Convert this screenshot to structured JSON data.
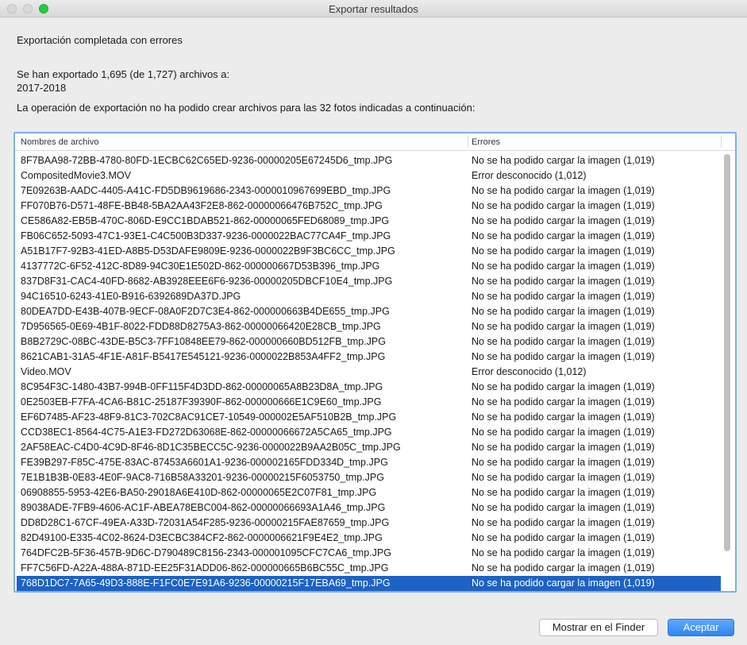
{
  "window": {
    "title": "Exportar resultados"
  },
  "status_text": "Exportación completada con errores",
  "summary": {
    "exported_line": "Se han exportado 1,695 (de 1,727) archivos a:",
    "destination": "2017-2018",
    "failure_message": "La operación de exportación no ha podido crear archivos para las 32 fotos indicadas a continuación:"
  },
  "table": {
    "columns": [
      "Nombres de archivo",
      "Errores"
    ],
    "rows": [
      {
        "file": "8F7BAA98-72BB-4780-80FD-1ECBC62C65ED-9236-00000205E67245D6_tmp.JPG",
        "error": "No se ha podido cargar la imagen (1,019)"
      },
      {
        "file": "CompositedMovie3.MOV",
        "error": "Error desconocido (1,012)"
      },
      {
        "file": "7E09263B-AADC-4405-A41C-FD5DB9619686-2343-0000010967699EBD_tmp.JPG",
        "error": "No se ha podido cargar la imagen (1,019)"
      },
      {
        "file": "FF070B76-D571-48FE-BB48-5BA2AA43F2E8-862-00000066476B752C_tmp.JPG",
        "error": "No se ha podido cargar la imagen (1,019)"
      },
      {
        "file": "CE586A82-EB5B-470C-806D-E9CC1BDAB521-862-00000065FED68089_tmp.JPG",
        "error": "No se ha podido cargar la imagen (1,019)"
      },
      {
        "file": "FB06C652-5093-47C1-93E1-C4C500B3D337-9236-0000022BAC77CA4F_tmp.JPG",
        "error": "No se ha podido cargar la imagen (1,019)"
      },
      {
        "file": "A51B17F7-92B3-41ED-A8B5-D53DAFE9809E-9236-0000022B9F3BC6CC_tmp.JPG",
        "error": "No se ha podido cargar la imagen (1,019)"
      },
      {
        "file": "4137772C-6F52-412C-8D89-94C30E1E502D-862-000000667D53B396_tmp.JPG",
        "error": "No se ha podido cargar la imagen (1,019)"
      },
      {
        "file": "837D8F31-CAC4-40FD-8682-AB3928EEE6F6-9236-00000205DBCF10E4_tmp.JPG",
        "error": "No se ha podido cargar la imagen (1,019)"
      },
      {
        "file": "94C16510-6243-41E0-B916-6392689DA37D.JPG",
        "error": "No se ha podido cargar la imagen (1,019)"
      },
      {
        "file": "80DEA7DD-E43B-407B-9ECF-08A0F2D7C3E4-862-000000663B4DE655_tmp.JPG",
        "error": "No se ha podido cargar la imagen (1,019)"
      },
      {
        "file": "7D956565-0E69-4B1F-8022-FDD88D8275A3-862-00000066420E28CB_tmp.JPG",
        "error": "No se ha podido cargar la imagen (1,019)"
      },
      {
        "file": "B8B2729C-08BC-43DE-B5C3-7FF10848EE79-862-000000660BD512FB_tmp.JPG",
        "error": "No se ha podido cargar la imagen (1,019)"
      },
      {
        "file": "8621CAB1-31A5-4F1E-A81F-B5417E545121-9236-0000022B853A4FF2_tmp.JPG",
        "error": "No se ha podido cargar la imagen (1,019)"
      },
      {
        "file": "Video.MOV",
        "error": "Error desconocido (1,012)"
      },
      {
        "file": "8C954F3C-1480-43B7-994B-0FF115F4D3DD-862-00000065A8B23D8A_tmp.JPG",
        "error": "No se ha podido cargar la imagen (1,019)"
      },
      {
        "file": "0E2503EB-F7FA-4CA6-B81C-25187F39390F-862-000000666E1C9E60_tmp.JPG",
        "error": "No se ha podido cargar la imagen (1,019)"
      },
      {
        "file": "EF6D7485-AF23-48F9-81C3-702C8AC91CE7-10549-000002E5AF510B2B_tmp.JPG",
        "error": "No se ha podido cargar la imagen (1,019)"
      },
      {
        "file": "CCD38EC1-8564-4C75-A1E3-FD272D63068E-862-00000066672A5CA65_tmp.JPG",
        "error": "No se ha podido cargar la imagen (1,019)"
      },
      {
        "file": "2AF58EAC-C4D0-4C9D-8F46-8D1C35BECC5C-9236-0000022B9AA2B05C_tmp.JPG",
        "error": "No se ha podido cargar la imagen (1,019)"
      },
      {
        "file": "FE39B297-F85C-475E-83AC-87453A6601A1-9236-000002165FDD334D_tmp.JPG",
        "error": "No se ha podido cargar la imagen (1,019)"
      },
      {
        "file": "7E1B1B3B-0E83-4E0F-9AC8-716B58A33201-9236-00000215F6053750_tmp.JPG",
        "error": "No se ha podido cargar la imagen (1,019)"
      },
      {
        "file": "06908855-5953-42E6-BA50-29018A6E410D-862-00000065E2C07F81_tmp.JPG",
        "error": "No se ha podido cargar la imagen (1,019)"
      },
      {
        "file": "89038ADE-7FB9-4606-AC1F-ABEA78EBC004-862-00000066693A1A46_tmp.JPG",
        "error": "No se ha podido cargar la imagen (1,019)"
      },
      {
        "file": "DD8D28C1-67CF-49EA-A33D-72031A54F285-9236-00000215FAE87659_tmp.JPG",
        "error": "No se ha podido cargar la imagen (1,019)"
      },
      {
        "file": "82D49100-E335-4C02-8624-D3ECBC384CF2-862-0000006621F9E4E2_tmp.JPG",
        "error": "No se ha podido cargar la imagen (1,019)"
      },
      {
        "file": "764DFC2B-5F36-457B-9D6C-D790489C8156-2343-000001095CFC7CA6_tmp.JPG",
        "error": "No se ha podido cargar la imagen (1,019)"
      },
      {
        "file": "FF7C56FD-A22A-488A-871D-EE25F31ADD06-862-000000665B6BC55C_tmp.JPG",
        "error": "No se ha podido cargar la imagen (1,019)"
      },
      {
        "file": "768D1DC7-7A65-49D3-888E-F1FC0E7E91A6-9236-00000215F17EBA69_tmp.JPG",
        "error": "No se ha podido cargar la imagen (1,019)",
        "selected": true
      }
    ]
  },
  "buttons": {
    "show_in_finder": "Mostrar en el Finder",
    "accept": "Aceptar"
  },
  "colors": {
    "selection": "#1d62c4",
    "focus_ring": "#7fb0ea",
    "default_button": "#2f86f2"
  }
}
